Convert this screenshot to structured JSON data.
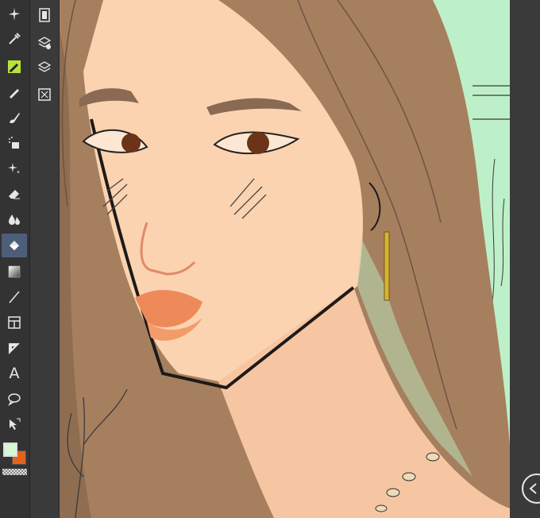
{
  "tools": [
    {
      "name": "magic-wand-icon"
    },
    {
      "name": "eyedropper-icon"
    },
    {
      "name": "pen-icon",
      "active": "highlight"
    },
    {
      "name": "pencil-icon"
    },
    {
      "name": "brush-icon"
    },
    {
      "name": "airbrush-icon"
    },
    {
      "name": "sparkle-decoration-icon"
    },
    {
      "name": "eraser-icon"
    },
    {
      "name": "blend-icon"
    },
    {
      "name": "fill-icon",
      "active": "selected"
    },
    {
      "name": "gradient-icon"
    },
    {
      "name": "line-figure-icon"
    },
    {
      "name": "frame-border-icon"
    },
    {
      "name": "ruler-icon"
    },
    {
      "name": "text-icon",
      "label": "A"
    },
    {
      "name": "balloon-icon"
    },
    {
      "name": "operation-icon"
    }
  ],
  "subtools": [
    {
      "name": "film-strip-icon"
    },
    {
      "name": "layer-property-icon"
    },
    {
      "name": "layers-icon"
    },
    {
      "name": "navigator-icon"
    }
  ],
  "colors": {
    "main": "#d6f7d4",
    "sub": "#e2641a",
    "active_tool": "#4d5e7a",
    "pen_highlight": "#b8e23b",
    "canvas_background": "#bdf0c8"
  }
}
